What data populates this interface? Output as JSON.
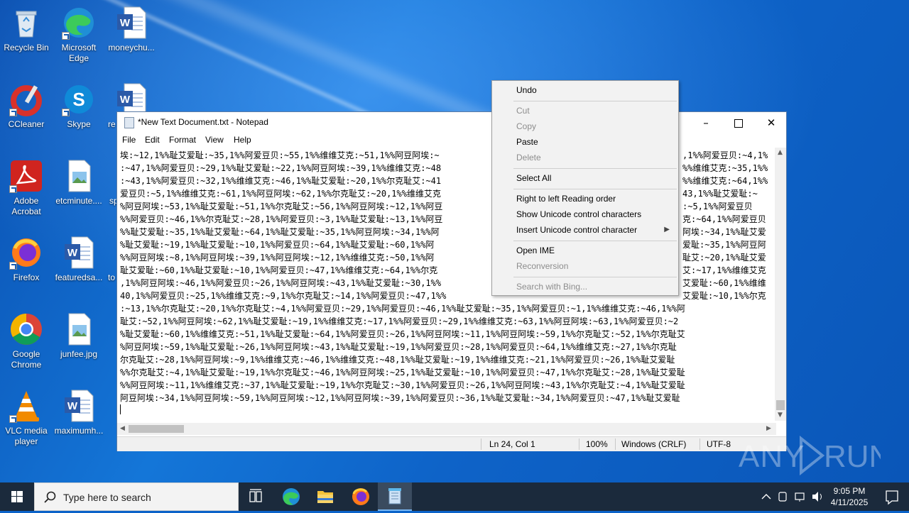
{
  "desktop": {
    "icons": [
      {
        "label": "Recycle Bin"
      },
      {
        "label": "Microsoft Edge"
      },
      {
        "label": "moneychu..."
      },
      {
        "label": "CCleaner"
      },
      {
        "label": "Skype"
      },
      {
        "label": "re"
      },
      {
        "label": "Adobe Acrobat"
      },
      {
        "label": "etcminute...."
      },
      {
        "label": "sp"
      },
      {
        "label": "Firefox"
      },
      {
        "label": "featuredsa..."
      },
      {
        "label": "to"
      },
      {
        "label": "Google Chrome"
      },
      {
        "label": "junfee.jpg"
      },
      {
        "label": "VLC media player"
      },
      {
        "label": "maximumh..."
      }
    ]
  },
  "notepad": {
    "title": "*New Text Document.txt - Notepad",
    "menu": [
      "File",
      "Edit",
      "Format",
      "View",
      "Help"
    ],
    "lines": [
      "埃:~12,1%%耻艾爱耻:~35,1%%阿爱豆贝:~55,1%%维维艾克:~51,1%%阿豆阿埃:~",
      ":~47,1%%阿爱豆贝:~29,1%%耻艾爱耻:~22,1%%阿豆阿埃:~39,1%%维维艾克:~48",
      ":~43,1%%阿爱豆贝:~32,1%%维维艾克:~46,1%%耻艾爱耻:~20,1%%尔克耻艾:~41",
      "爱豆贝:~5,1%%维维艾克:~61,1%%阿豆阿埃:~62,1%%尔克耻艾:~20,1%%维维艾克",
      "%阿豆阿埃:~53,1%%耻艾爱耻:~51,1%%尔克耻艾:~56,1%%阿豆阿埃:~12,1%%阿豆",
      "%%阿爱豆贝:~46,1%%尔克耻艾:~28,1%%阿爱豆贝:~3,1%%耻艾爱耻:~13,1%%阿豆",
      "%%耻艾爱耻:~35,1%%耻艾爱耻:~64,1%%耻艾爱耻:~35,1%%阿豆阿埃:~34,1%%阿",
      "%耻艾爱耻:~19,1%%耻艾爱耻:~10,1%%阿爱豆贝:~64,1%%耻艾爱耻:~60,1%%阿",
      "%%阿豆阿埃:~8,1%%阿豆阿埃:~39,1%%阿豆阿埃:~12,1%%维维艾克:~50,1%%阿",
      "耻艾爱耻:~60,1%%耻艾爱耻:~10,1%%阿爱豆贝:~47,1%%维维艾克:~64,1%%尔克",
      ",1%%阿豆阿埃:~46,1%%阿爱豆贝:~26,1%%阿豆阿埃:~43,1%%耻艾爱耻:~30,1%%",
      "40,1%%阿爱豆贝:~25,1%%维维艾克:~9,1%%尔克耻艾:~14,1%%阿爱豆贝:~47,1%%",
      ":~13,1%%尔克耻艾:~20,1%%尔克耻艾:~4,1%%阿爱豆贝:~29,1%%阿爱豆贝:~46,1%%耻艾爱耻:~35,1%%阿爱豆贝:~1,1%%维维艾克:~46,1%%阿",
      "耻艾:~52,1%%阿豆阿埃:~62,1%%耻艾爱耻:~19,1%%维维艾克:~17,1%%阿爱豆贝:~29,1%%维维艾克:~63,1%%阿豆阿埃:~63,1%%阿爱豆贝:~2",
      "%耻艾爱耻:~60,1%%维维艾克:~51,1%%耻艾爱耻:~64,1%%阿爱豆贝:~26,1%%阿豆阿埃:~11,1%%阿豆阿埃:~59,1%%尔克耻艾:~52,1%%尔克耻艾",
      "%阿豆阿埃:~59,1%%耻艾爱耻:~26,1%%阿豆阿埃:~43,1%%耻艾爱耻:~19,1%%阿爱豆贝:~28,1%%阿爱豆贝:~64,1%%维维艾克:~27,1%%尔克耻",
      "尔克耻艾:~28,1%%阿豆阿埃:~9,1%%维维艾克:~46,1%%维维艾克:~48,1%%耻艾爱耻:~19,1%%维维艾克:~21,1%%阿爱豆贝:~26,1%%耻艾爱耻",
      "%%尔克耻艾:~4,1%%耻艾爱耻:~19,1%%尔克耻艾:~46,1%%阿豆阿埃:~25,1%%耻艾爱耻:~10,1%%阿爱豆贝:~47,1%%尔克耻艾:~28,1%%耻艾爱耻",
      "%%阿豆阿埃:~11,1%%维维艾克:~37,1%%耻艾爱耻:~19,1%%尔克耻艾:~30,1%%阿爱豆贝:~26,1%%阿豆阿埃:~43,1%%尔克耻艾:~4,1%%耻艾爱耻",
      "阿豆阿埃:~34,1%%阿豆阿埃:~59,1%%阿豆阿埃:~12,1%%阿豆阿埃:~39,1%%阿爱豆贝:~36,1%%耻艾爱耻:~34,1%%阿爱豆贝:~47,1%%耻艾爱耻"
    ],
    "right_fragments": [
      ",1%%阿爱豆贝:~4,1%",
      "%%维维艾克:~35,1%%",
      "%%维维艾克:~64,1%%",
      "43,1%%耻艾爱耻:~",
      ":~5,1%%阿爱豆贝",
      "克:~64,1%%阿爱豆贝",
      "阿埃:~34,1%%耻艾爱",
      "爱耻:~35,1%%阿豆阿",
      "耻艾:~20,1%%耻艾爱",
      "艾:~17,1%%维维艾克",
      "艾爱耻:~60,1%%维维",
      "艾爱耻:~10,1%%尔克"
    ],
    "status": {
      "position": "Ln 24, Col 1",
      "zoom": "100%",
      "line_ending": "Windows (CRLF)",
      "encoding": "UTF-8"
    }
  },
  "context_menu": {
    "undo": "Undo",
    "cut": "Cut",
    "copy": "Copy",
    "paste": "Paste",
    "delete": "Delete",
    "select_all": "Select All",
    "rtl": "Right to left Reading order",
    "show_unicode": "Show Unicode control characters",
    "insert_unicode": "Insert Unicode control character",
    "open_ime": "Open IME",
    "reconversion": "Reconversion",
    "search_bing": "Search with Bing..."
  },
  "taskbar": {
    "search_placeholder": "Type here to search",
    "time": "9:05 PM",
    "date": "4/11/2025"
  },
  "watermark": "ANY RUN"
}
